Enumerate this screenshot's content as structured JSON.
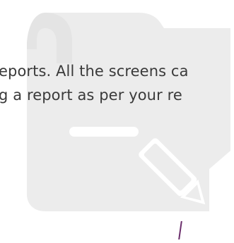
{
  "intro": {
    "line1": "eports. All the screens ca",
    "line2": "g a report as per your re"
  },
  "illustration": {
    "icon": "report-scroll-with-pencil-icon",
    "color": "#ececec"
  },
  "accent": {
    "color": "#6a2d6b"
  }
}
